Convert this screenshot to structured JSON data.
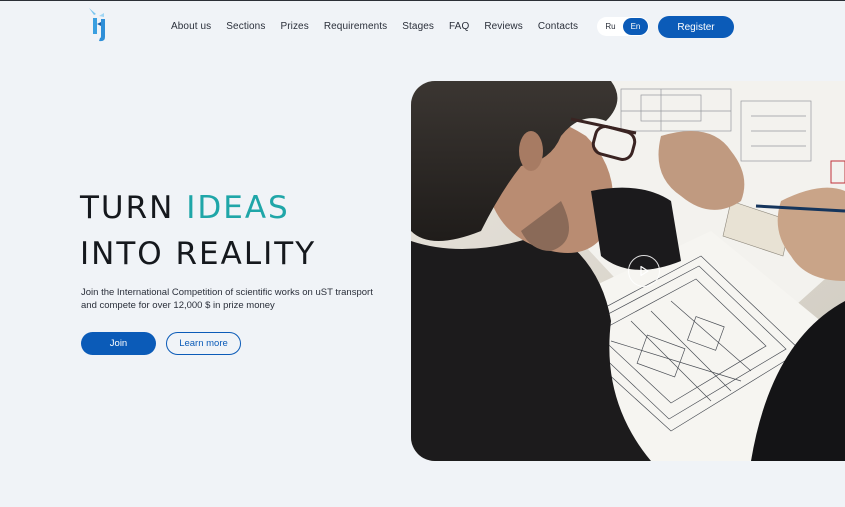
{
  "header": {
    "logo_icon": "brand-logo",
    "nav": [
      "About us",
      "Sections",
      "Prizes",
      "Requirements",
      "Stages",
      "FAQ",
      "Reviews",
      "Contacts"
    ],
    "lang_options": [
      "Ru",
      "En"
    ],
    "lang_active": "En",
    "register_label": "Register"
  },
  "hero": {
    "title_line1_plain": "TURN ",
    "title_line1_accent": "IDEAS",
    "title_line2": "INTO REALITY",
    "lead": "Join the International Competition of scientific works on uST transport and compete for over 12,000 $ in prize money",
    "join_label": "Join",
    "learn_label": "Learn more",
    "video_icon": "play-icon"
  },
  "colors": {
    "brand": "#0b5bb8",
    "accent": "#1fa6a8",
    "background": "#f0f3f7"
  }
}
